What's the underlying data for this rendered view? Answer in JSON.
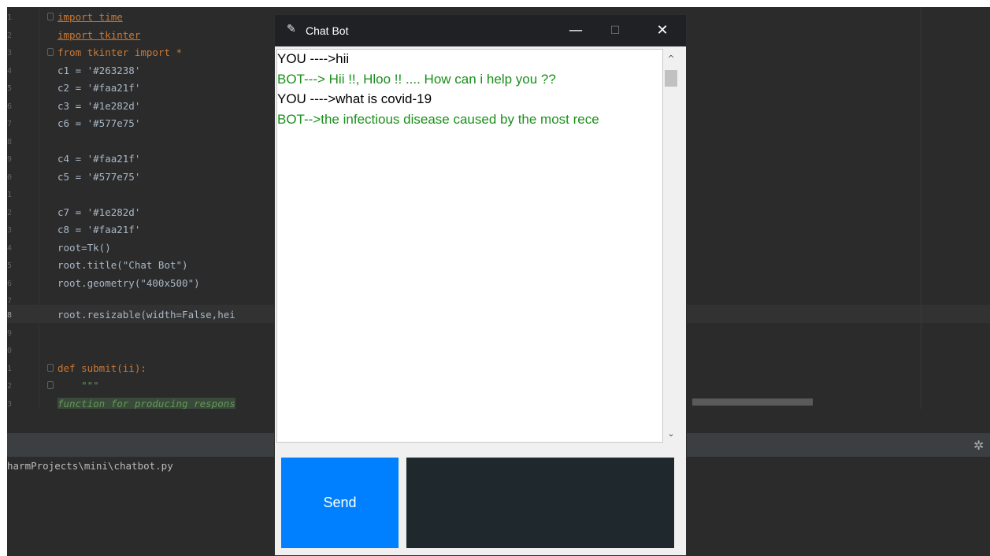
{
  "editor": {
    "line_numbers": [
      "1",
      "2",
      "3",
      "4",
      "5",
      "6",
      "7",
      "8",
      "9",
      "0",
      "1",
      "2",
      "3",
      "4",
      "5",
      "6",
      "7",
      "8",
      "9",
      "0",
      "1",
      "2",
      "3"
    ],
    "lines": [
      "import time",
      "import tkinter",
      "from tkinter import *",
      "c1 = '#263238'",
      "c2 = '#faa21f'",
      "c3 = '#1e282d'",
      "c6 = '#577e75'",
      "",
      "c4 = '#faa21f'",
      "c5 = '#577e75'",
      "",
      "c7 = '#1e282d'",
      "c8 = '#faa21f'",
      "root=Tk()",
      "root.title(\"Chat Bot\")",
      "root.geometry(\"400x500\")",
      "",
      "root.resizable(width=False,hei",
      "",
      "",
      "def submit(ii):",
      "    \"\"\"",
      "function for producing respons"
    ]
  },
  "terminal": {
    "path": "harmProjects\\mini\\chatbot.py"
  },
  "chat_window": {
    "title": "Chat Bot",
    "minimize": "—",
    "maximize": "☐",
    "close": "✕",
    "messages": [
      {
        "sender": "user",
        "text": "YOU  ---->hii"
      },
      {
        "sender": "bot",
        "text": "BOT--->  Hii !!, Hloo !! .... How can i help you ??"
      },
      {
        "sender": "user",
        "text": "YOU  ---->what is covid-19"
      },
      {
        "sender": "bot",
        "text": "BOT-->the infectious disease caused by the most rece"
      }
    ],
    "scroll_up": "^",
    "scroll_down": "⌄",
    "send_label": "Send",
    "input_value": ""
  },
  "colors": {
    "send_button": "#0080ff",
    "entry_background": "#1e282d",
    "bot_text": "#1a8f1a"
  }
}
